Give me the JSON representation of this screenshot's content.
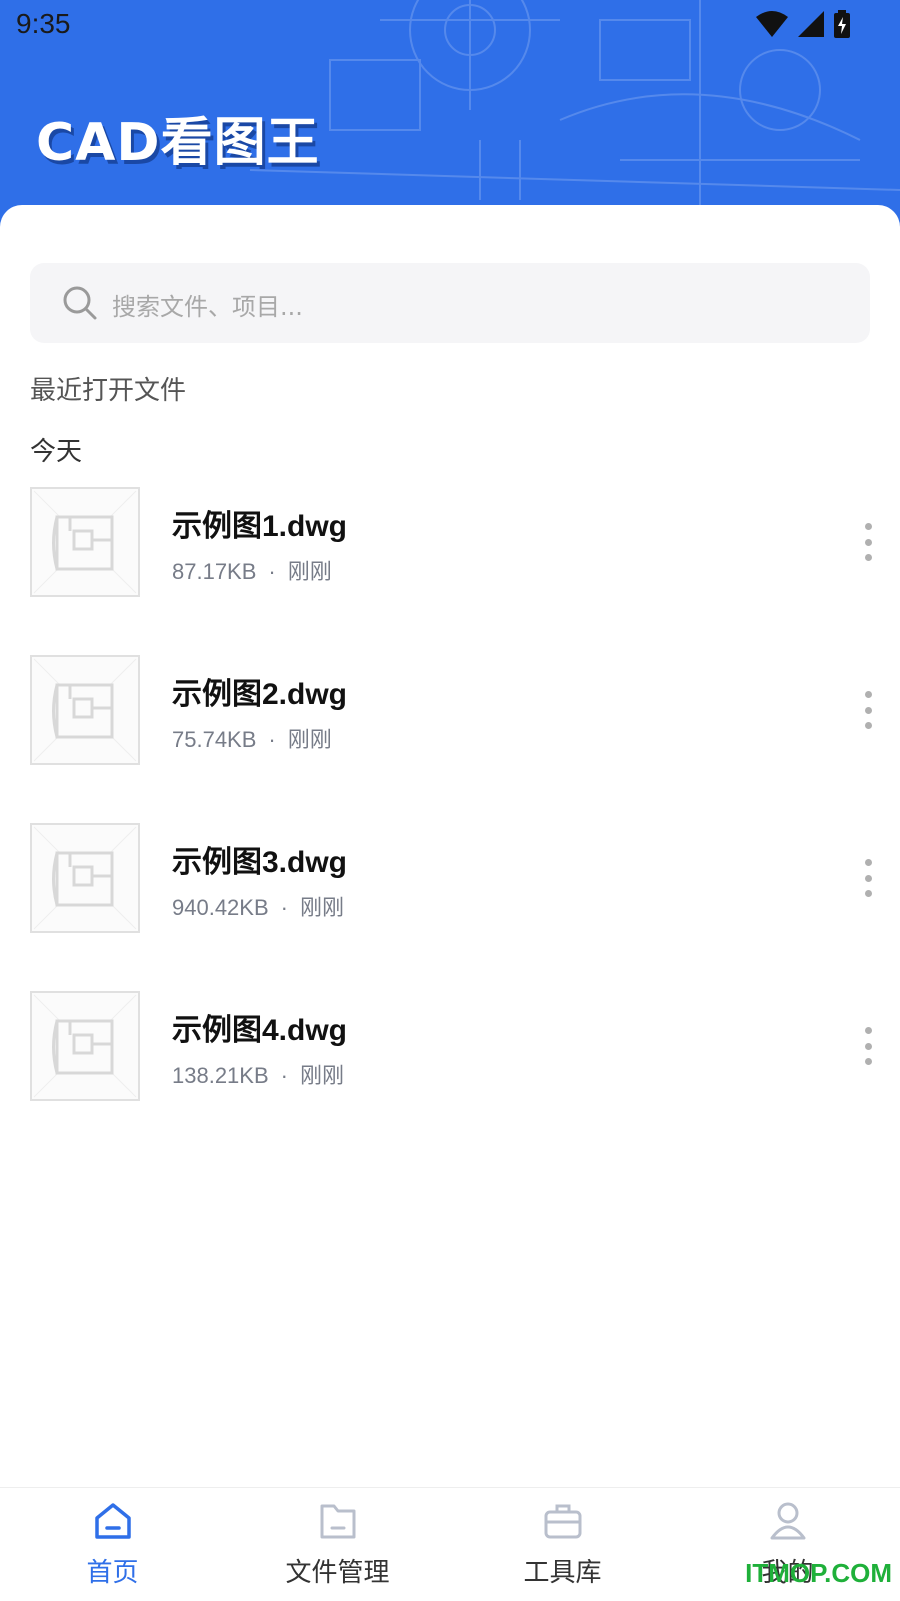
{
  "status_bar": {
    "time": "9:35"
  },
  "header": {
    "logo_text": "CAD看图王",
    "background_color": "#2f6fe8"
  },
  "search": {
    "placeholder": "搜索文件、项目..."
  },
  "recent": {
    "section_title": "最近打开文件",
    "group_title": "今天",
    "files": [
      {
        "name": "示例图1.dwg",
        "size": "87.17KB",
        "time": "刚刚"
      },
      {
        "name": "示例图2.dwg",
        "size": "75.74KB",
        "time": "刚刚"
      },
      {
        "name": "示例图3.dwg",
        "size": "940.42KB",
        "time": "刚刚"
      },
      {
        "name": "示例图4.dwg",
        "size": "138.21KB",
        "time": "刚刚"
      }
    ],
    "separator": "·"
  },
  "tabbar": {
    "tabs": [
      {
        "label": "首页",
        "icon": "home-icon",
        "active": true
      },
      {
        "label": "文件管理",
        "icon": "folder-icon",
        "active": false
      },
      {
        "label": "工具库",
        "icon": "toolbox-icon",
        "active": false
      },
      {
        "label": "我的",
        "icon": "user-icon",
        "active": false
      }
    ],
    "active_color": "#2f6fe8"
  },
  "watermark": "ITMOP.COM"
}
